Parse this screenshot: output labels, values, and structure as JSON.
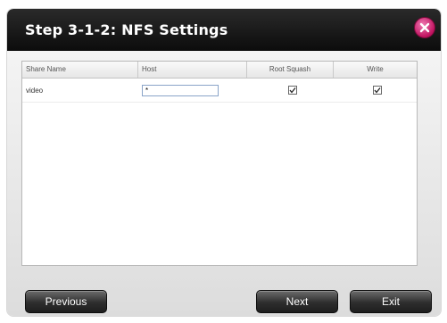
{
  "dialog": {
    "title": "Step 3-1-2: NFS Settings",
    "close_icon": "close-icon",
    "accent_color": "#c0125f"
  },
  "table": {
    "columns": [
      "Share Name",
      "Host",
      "Root Squash",
      "Write"
    ],
    "rows": [
      {
        "share_name": "video",
        "host": "*",
        "root_squash": true,
        "write": true
      }
    ]
  },
  "buttons": {
    "previous": "Previous",
    "next": "Next",
    "exit": "Exit"
  }
}
